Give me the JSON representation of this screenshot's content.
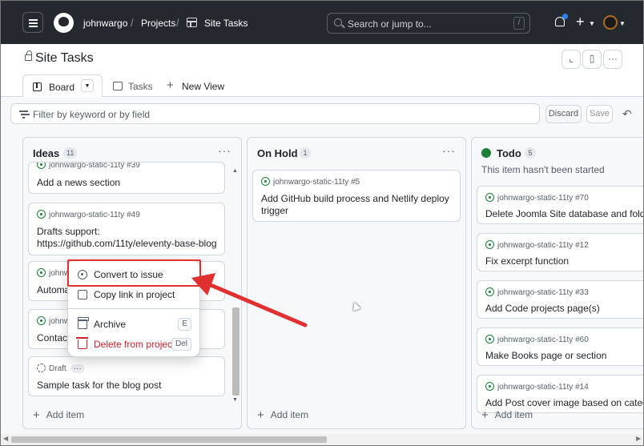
{
  "header": {
    "owner": "johnwargo",
    "projects": "Projects",
    "project": "Site Tasks",
    "search_placeholder": "Search or jump to...",
    "search_key": "/"
  },
  "page": {
    "title": "Site Tasks",
    "tabs": [
      {
        "label": "Board"
      },
      {
        "label": "Tasks"
      },
      {
        "label": "New View"
      }
    ],
    "filter_placeholder": "Filter by keyword or by field",
    "discard": "Discard",
    "save": "Save"
  },
  "columns": {
    "ideas": {
      "title": "Ideas",
      "count": "11",
      "cards": [
        {
          "issue": "johnwargo-static-11ty #39",
          "title": "Add a news section"
        },
        {
          "issue": "johnwargo-static-11ty #49",
          "title": "Drafts support:\nhttps://github.com/11ty/eleventy-base-blog"
        },
        {
          "issue": "johnw",
          "title": "Automa"
        },
        {
          "issue": "johnw",
          "title": "Contact"
        },
        {
          "issue": "Draft",
          "title": "Sample task for the blog post"
        }
      ],
      "add_item": "Add item"
    },
    "onhold": {
      "title": "On Hold",
      "count": "1",
      "cards": [
        {
          "issue": "johnwargo-static-11ty #5",
          "title": "Add GitHub build process and Netlify deploy trigger"
        }
      ],
      "add_item": "Add item"
    },
    "todo": {
      "title": "Todo",
      "count": "5",
      "description": "This item hasn't been started",
      "status_color": "#1a7f37",
      "cards": [
        {
          "issue": "johnwargo-static-11ty #70",
          "title": "Delete Joomla Site database and folder"
        },
        {
          "issue": "johnwargo-static-11ty #12",
          "title": "Fix excerpt function"
        },
        {
          "issue": "johnwargo-static-11ty #33",
          "title": "Add Code projects page(s)"
        },
        {
          "issue": "johnwargo-static-11ty #60",
          "title": "Make Books page or section"
        },
        {
          "issue": "johnwargo-static-11ty #14",
          "title": "Add Post cover image based on category"
        }
      ],
      "add_item": "Add item"
    }
  },
  "context_menu": {
    "convert": "Convert to issue",
    "copy": "Copy link in project",
    "archive": "Archive",
    "archive_key": "E",
    "delete": "Delete from project",
    "delete_key": "Del"
  },
  "colors": {
    "header_bg": "#24292f",
    "open_issue": "#1a7f37",
    "danger": "#cf222e",
    "annotation": "#e03030"
  }
}
